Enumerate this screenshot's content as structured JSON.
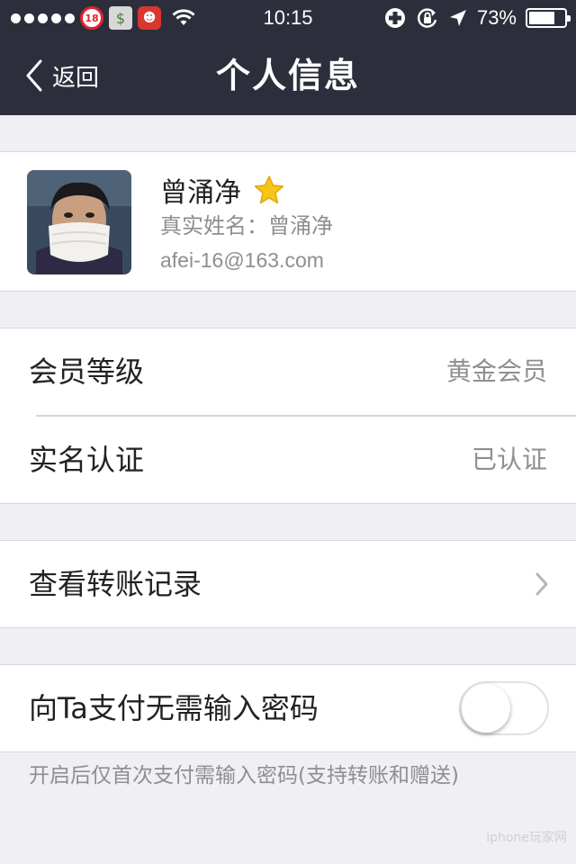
{
  "status_bar": {
    "time": "10:15",
    "battery_percent_text": "73%",
    "battery_level": 0.73,
    "status_icons": [
      "age-restriction-18-emoji",
      "money-emoji",
      "ogre-mask-emoji",
      "wifi-icon",
      "medical-cross-icon",
      "rotation-lock-icon",
      "location-arrow-icon",
      "battery-icon"
    ],
    "age_badge": "18"
  },
  "nav": {
    "back_label": "返回",
    "title": "个人信息"
  },
  "profile": {
    "name": "曾涌净",
    "real_name_line": "真实姓名：曾涌净",
    "email": "afei-16@163.com",
    "badge_icon": "star-icon"
  },
  "rows": {
    "member_level": {
      "label": "会员等级",
      "value": "黄金会员"
    },
    "real_name_auth": {
      "label": "实名认证",
      "value": "已认证"
    },
    "transfer_records": {
      "label": "查看转账记录"
    },
    "no_password": {
      "label": "向Ta支付无需输入密码",
      "enabled": false
    }
  },
  "footnote": "开启后仅首次支付需输入密码(支持转账和赠送)",
  "watermark": "iphone玩家网",
  "colors": {
    "bar_bg": "#2c2f3b",
    "page_bg": "#efeff4",
    "secondary_text": "#8e8e93",
    "star": "#f5c518"
  }
}
